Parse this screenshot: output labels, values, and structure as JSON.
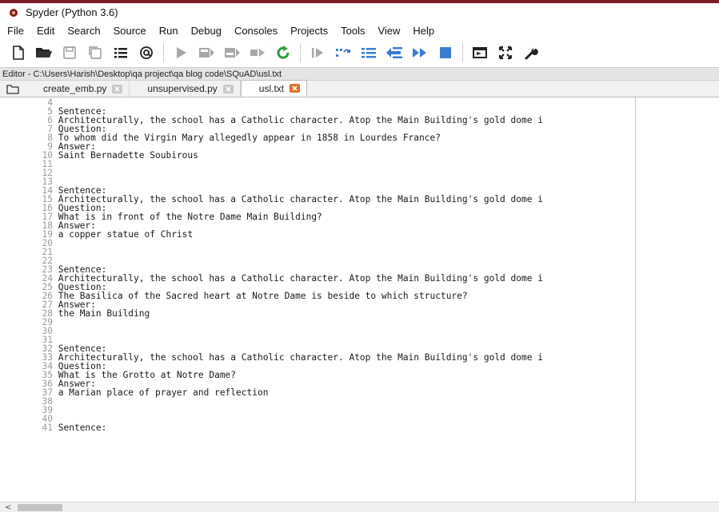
{
  "window": {
    "title": "Spyder (Python 3.6)",
    "app_icon": "spyder-logo-icon"
  },
  "menu": [
    "File",
    "Edit",
    "Search",
    "Source",
    "Run",
    "Debug",
    "Consoles",
    "Projects",
    "Tools",
    "View",
    "Help"
  ],
  "toolbar": [
    "new-file-icon",
    "open-folder-icon",
    "save-icon",
    "save-all-icon",
    "outline-icon",
    "at-sign-icon",
    "run-icon",
    "run-cell-icon",
    "run-cell-advance-icon",
    "run-selection-icon",
    "rerun-icon",
    "debug-icon",
    "step-icon",
    "step-into-icon",
    "step-return-icon",
    "continue-icon",
    "stop-icon",
    "maximize-pane-icon",
    "fullscreen-icon",
    "preferences-icon"
  ],
  "editor": {
    "path": "Editor - C:\\Users\\Harish\\Desktop\\qa project\\qa blog code\\SQuAD\\usl.txt",
    "tabs": [
      {
        "label": "create_emb.py",
        "active": false
      },
      {
        "label": "unsupervised.py",
        "active": false
      },
      {
        "label": "usl.txt",
        "active": true
      }
    ],
    "lines": [
      {
        "n": "4",
        "text": ""
      },
      {
        "n": "5",
        "text": "Sentence:"
      },
      {
        "n": "6",
        "text": "Architecturally, the school has a Catholic character. Atop the Main Building's gold dome i"
      },
      {
        "n": "7",
        "text": "Question:"
      },
      {
        "n": "8",
        "text": "To whom did the Virgin Mary allegedly appear in 1858 in Lourdes France?"
      },
      {
        "n": "9",
        "text": "Answer:"
      },
      {
        "n": "10",
        "text": "Saint Bernadette Soubirous"
      },
      {
        "n": "11",
        "text": ""
      },
      {
        "n": "12",
        "text": ""
      },
      {
        "n": "13",
        "text": ""
      },
      {
        "n": "14",
        "text": "Sentence:"
      },
      {
        "n": "15",
        "text": "Architecturally, the school has a Catholic character. Atop the Main Building's gold dome i"
      },
      {
        "n": "16",
        "text": "Question:"
      },
      {
        "n": "17",
        "text": "What is in front of the Notre Dame Main Building?"
      },
      {
        "n": "18",
        "text": "Answer:"
      },
      {
        "n": "19",
        "text": "a copper statue of Christ"
      },
      {
        "n": "20",
        "text": ""
      },
      {
        "n": "21",
        "text": ""
      },
      {
        "n": "22",
        "text": ""
      },
      {
        "n": "23",
        "text": "Sentence:"
      },
      {
        "n": "24",
        "text": "Architecturally, the school has a Catholic character. Atop the Main Building's gold dome i"
      },
      {
        "n": "25",
        "text": "Question:"
      },
      {
        "n": "26",
        "text": "The Basilica of the Sacred heart at Notre Dame is beside to which structure?"
      },
      {
        "n": "27",
        "text": "Answer:"
      },
      {
        "n": "28",
        "text": "the Main Building"
      },
      {
        "n": "29",
        "text": ""
      },
      {
        "n": "30",
        "text": ""
      },
      {
        "n": "31",
        "text": ""
      },
      {
        "n": "32",
        "text": "Sentence:"
      },
      {
        "n": "33",
        "text": "Architecturally, the school has a Catholic character. Atop the Main Building's gold dome i"
      },
      {
        "n": "34",
        "text": "Question:"
      },
      {
        "n": "35",
        "text": "What is the Grotto at Notre Dame?"
      },
      {
        "n": "36",
        "text": "Answer:"
      },
      {
        "n": "37",
        "text": "a Marian place of prayer and reflection"
      },
      {
        "n": "38",
        "text": ""
      },
      {
        "n": "39",
        "text": ""
      },
      {
        "n": "40",
        "text": ""
      },
      {
        "n": "41",
        "text": "Sentence:"
      }
    ]
  },
  "scrollbar": {
    "left_arrow": "<"
  }
}
